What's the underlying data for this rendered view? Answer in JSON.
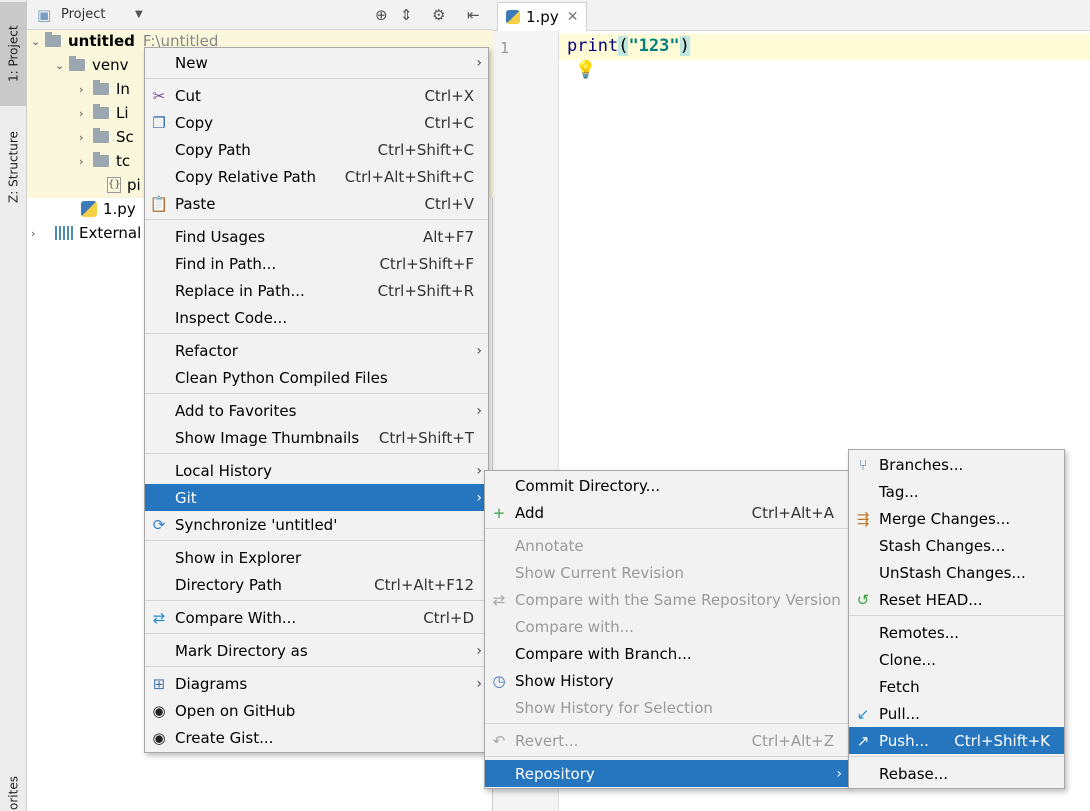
{
  "sidebar": {
    "project_tab": "1: Project",
    "structure_tab": "Z: Structure",
    "favorites_tab": "orites"
  },
  "project_panel": {
    "title": "Project",
    "tree": [
      {
        "label": "untitled",
        "suffix": "F:\\untitled"
      },
      {
        "label": "venv"
      },
      {
        "label": "In"
      },
      {
        "label": "Li"
      },
      {
        "label": "Sc"
      },
      {
        "label": "tc"
      },
      {
        "label": "pi"
      },
      {
        "label": "1.py"
      },
      {
        "label": "External L"
      }
    ]
  },
  "editor": {
    "tab_label": "1.py",
    "line_number": "1",
    "code": {
      "func": "print",
      "open": "(",
      "arg": "\"123\"",
      "close": ")"
    }
  },
  "context_menu": [
    {
      "label": "New",
      "shortcut": "",
      "submenu": true
    },
    {
      "label": "Cut",
      "shortcut": "Ctrl+X",
      "icon": "scissors-icon"
    },
    {
      "label": "Copy",
      "shortcut": "Ctrl+C",
      "icon": "copy-icon"
    },
    {
      "label": "Copy Path",
      "shortcut": "Ctrl+Shift+C"
    },
    {
      "label": "Copy Relative Path",
      "shortcut": "Ctrl+Alt+Shift+C"
    },
    {
      "label": "Paste",
      "shortcut": "Ctrl+V",
      "icon": "paste-icon"
    },
    {
      "label": "Find Usages",
      "shortcut": "Alt+F7"
    },
    {
      "label": "Find in Path...",
      "shortcut": "Ctrl+Shift+F"
    },
    {
      "label": "Replace in Path...",
      "shortcut": "Ctrl+Shift+R"
    },
    {
      "label": "Inspect Code...",
      "shortcut": ""
    },
    {
      "label": "Refactor",
      "shortcut": "",
      "submenu": true
    },
    {
      "label": "Clean Python Compiled Files",
      "shortcut": ""
    },
    {
      "label": "Add to Favorites",
      "shortcut": "",
      "submenu": true
    },
    {
      "label": "Show Image Thumbnails",
      "shortcut": "Ctrl+Shift+T"
    },
    {
      "label": "Local History",
      "shortcut": "",
      "submenu": true
    },
    {
      "label": "Git",
      "shortcut": "",
      "submenu": true,
      "selected": true
    },
    {
      "label": "Synchronize 'untitled'",
      "shortcut": "",
      "icon": "sync-icon"
    },
    {
      "label": "Show in Explorer",
      "shortcut": ""
    },
    {
      "label": "Directory Path",
      "shortcut": "Ctrl+Alt+F12"
    },
    {
      "label": "Compare With...",
      "shortcut": "Ctrl+D",
      "icon": "compare-icon"
    },
    {
      "label": "Mark Directory as",
      "shortcut": "",
      "submenu": true
    },
    {
      "label": "Diagrams",
      "shortcut": "",
      "submenu": true,
      "icon": "diagram-icon"
    },
    {
      "label": "Open on GitHub",
      "shortcut": "",
      "icon": "github-icon"
    },
    {
      "label": "Create Gist...",
      "shortcut": "",
      "icon": "github-icon"
    }
  ],
  "git_menu": [
    {
      "label": "Commit Directory...",
      "shortcut": ""
    },
    {
      "label": "Add",
      "shortcut": "Ctrl+Alt+A",
      "icon": "plus-icon"
    },
    {
      "label": "Annotate",
      "shortcut": "",
      "disabled": true
    },
    {
      "label": "Show Current Revision",
      "shortcut": "",
      "disabled": true
    },
    {
      "label": "Compare with the Same Repository Version",
      "shortcut": "",
      "disabled": true,
      "icon": "compare-icon"
    },
    {
      "label": "Compare with...",
      "shortcut": "",
      "disabled": true
    },
    {
      "label": "Compare with Branch...",
      "shortcut": ""
    },
    {
      "label": "Show History",
      "shortcut": "",
      "icon": "history-icon"
    },
    {
      "label": "Show History for Selection",
      "shortcut": "",
      "disabled": true
    },
    {
      "label": "Revert...",
      "shortcut": "Ctrl+Alt+Z",
      "disabled": true,
      "icon": "revert-icon"
    },
    {
      "label": "Repository",
      "shortcut": "",
      "submenu": true,
      "selected": true
    }
  ],
  "repository_menu": [
    {
      "label": "Branches...",
      "shortcut": "",
      "icon": "branch-icon"
    },
    {
      "label": "Tag...",
      "shortcut": ""
    },
    {
      "label": "Merge Changes...",
      "shortcut": "",
      "icon": "merge-icon"
    },
    {
      "label": "Stash Changes...",
      "shortcut": ""
    },
    {
      "label": "UnStash Changes...",
      "shortcut": ""
    },
    {
      "label": "Reset HEAD...",
      "shortcut": "",
      "icon": "reset-icon"
    },
    {
      "label": "Remotes...",
      "shortcut": ""
    },
    {
      "label": "Clone...",
      "shortcut": ""
    },
    {
      "label": "Fetch",
      "shortcut": ""
    },
    {
      "label": "Pull...",
      "shortcut": "",
      "icon": "pull-icon"
    },
    {
      "label": "Push...",
      "shortcut": "Ctrl+Shift+K",
      "icon": "push-icon",
      "selected": true
    },
    {
      "label": "Rebase...",
      "shortcut": ""
    }
  ]
}
